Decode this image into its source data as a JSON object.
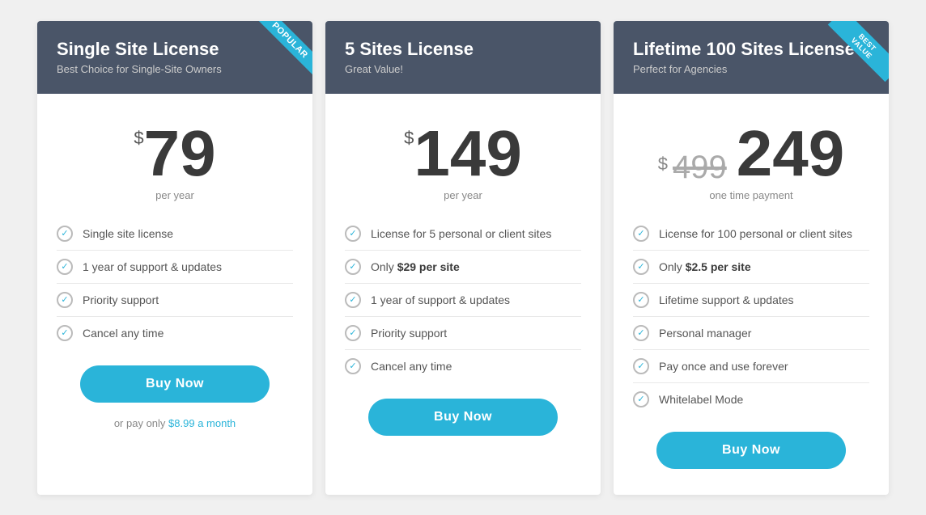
{
  "cards": [
    {
      "id": "single-site",
      "badge": "POPULAR",
      "title": "Single Site License",
      "subtitle": "Best Choice for Single-Site Owners",
      "price_dollar": "$",
      "price_value": "79",
      "price_period": "per year",
      "price_old": null,
      "price_new": null,
      "one_time": false,
      "features": [
        "Single site license",
        "1 year of support & updates",
        "Priority support",
        "Cancel any time"
      ],
      "features_html": [
        "Single site license",
        "1 year of support & updates",
        "Priority support",
        "Cancel any time"
      ],
      "buy_label": "Buy Now",
      "note": "or pay only",
      "note_link": "$8.99 a month",
      "note_suffix": ""
    },
    {
      "id": "five-sites",
      "badge": null,
      "title": "5 Sites License",
      "subtitle": "Great Value!",
      "price_dollar": "$",
      "price_value": "149",
      "price_period": "per year",
      "price_old": null,
      "price_new": null,
      "one_time": false,
      "features": [
        "License for 5 personal or client sites",
        "Only $29 per site",
        "1 year of support & updates",
        "Priority support",
        "Cancel any time"
      ],
      "features_bold": [
        "$29 per site"
      ],
      "buy_label": "Buy Now",
      "note": null
    },
    {
      "id": "lifetime",
      "badge": "BEST VALUE",
      "title": "Lifetime 100 Sites License",
      "subtitle": "Perfect for Agencies",
      "price_dollar": "$",
      "price_old_value": "499",
      "price_value": "249",
      "price_period": "one time payment",
      "one_time": true,
      "features": [
        "License for 100 personal or client sites",
        "Only $2.5 per site",
        "Lifetime support & updates",
        "Personal manager",
        "Pay once and use forever",
        "Whitelabel Mode"
      ],
      "features_bold": [
        "$2.5 per site"
      ],
      "buy_label": "Buy Now",
      "note": null
    }
  ]
}
